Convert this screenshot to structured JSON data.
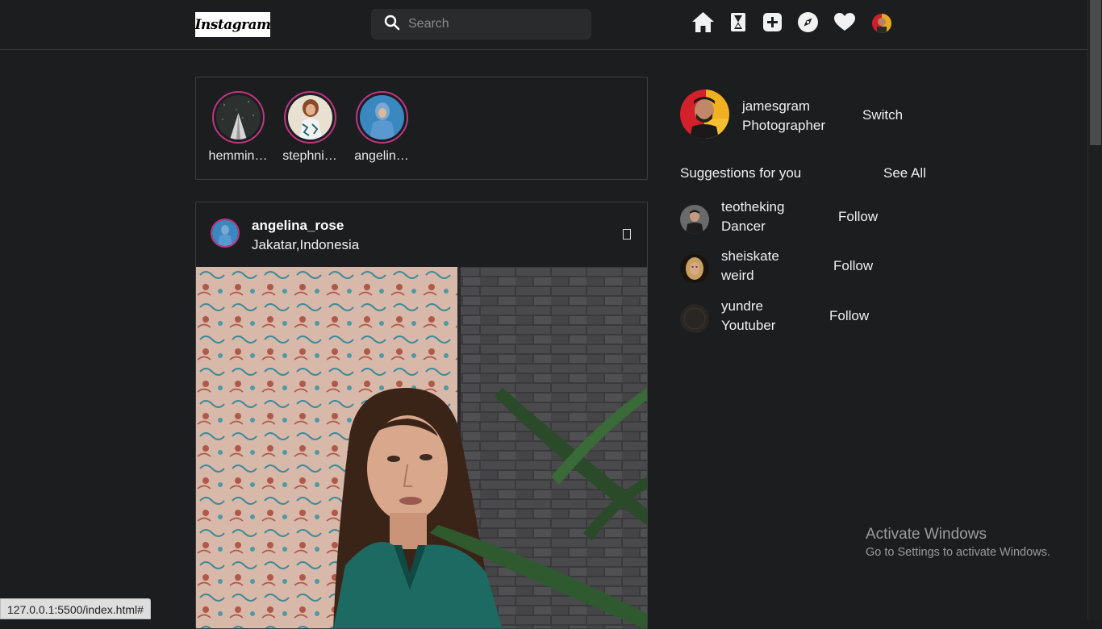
{
  "header": {
    "logo_text": "Instagram",
    "search_placeholder": "Search",
    "nav_icons": [
      "home-icon",
      "hourglass-icon",
      "add-post-icon",
      "explore-compass-icon",
      "heart-icon",
      "avatar"
    ]
  },
  "stories": [
    {
      "name": "hemmin…"
    },
    {
      "name": "stephni…"
    },
    {
      "name": "angelin…"
    }
  ],
  "post": {
    "username": "angelina_rose",
    "location": "Jakatar,Indonesia"
  },
  "profile": {
    "username": "jamesgram",
    "subtitle": "Photographer",
    "switch_label": "Switch"
  },
  "suggestions": {
    "title": "Suggestions for you",
    "see_all_label": "See All",
    "items": [
      {
        "name": "teotheking",
        "role": "Dancer",
        "action": "Follow"
      },
      {
        "name": "sheiskate",
        "role": "weird",
        "action": "Follow"
      },
      {
        "name": "yundre",
        "role": "Youtuber",
        "action": "Follow"
      }
    ]
  },
  "watermark": {
    "title": "Activate Windows",
    "subtitle": "Go to Settings to activate Windows."
  },
  "status_bar": {
    "url": "127.0.0.1:5500/index.html#"
  },
  "colors": {
    "background": "#1c1d1f",
    "story_ring": "#c13584",
    "border": "#3d3e40"
  }
}
